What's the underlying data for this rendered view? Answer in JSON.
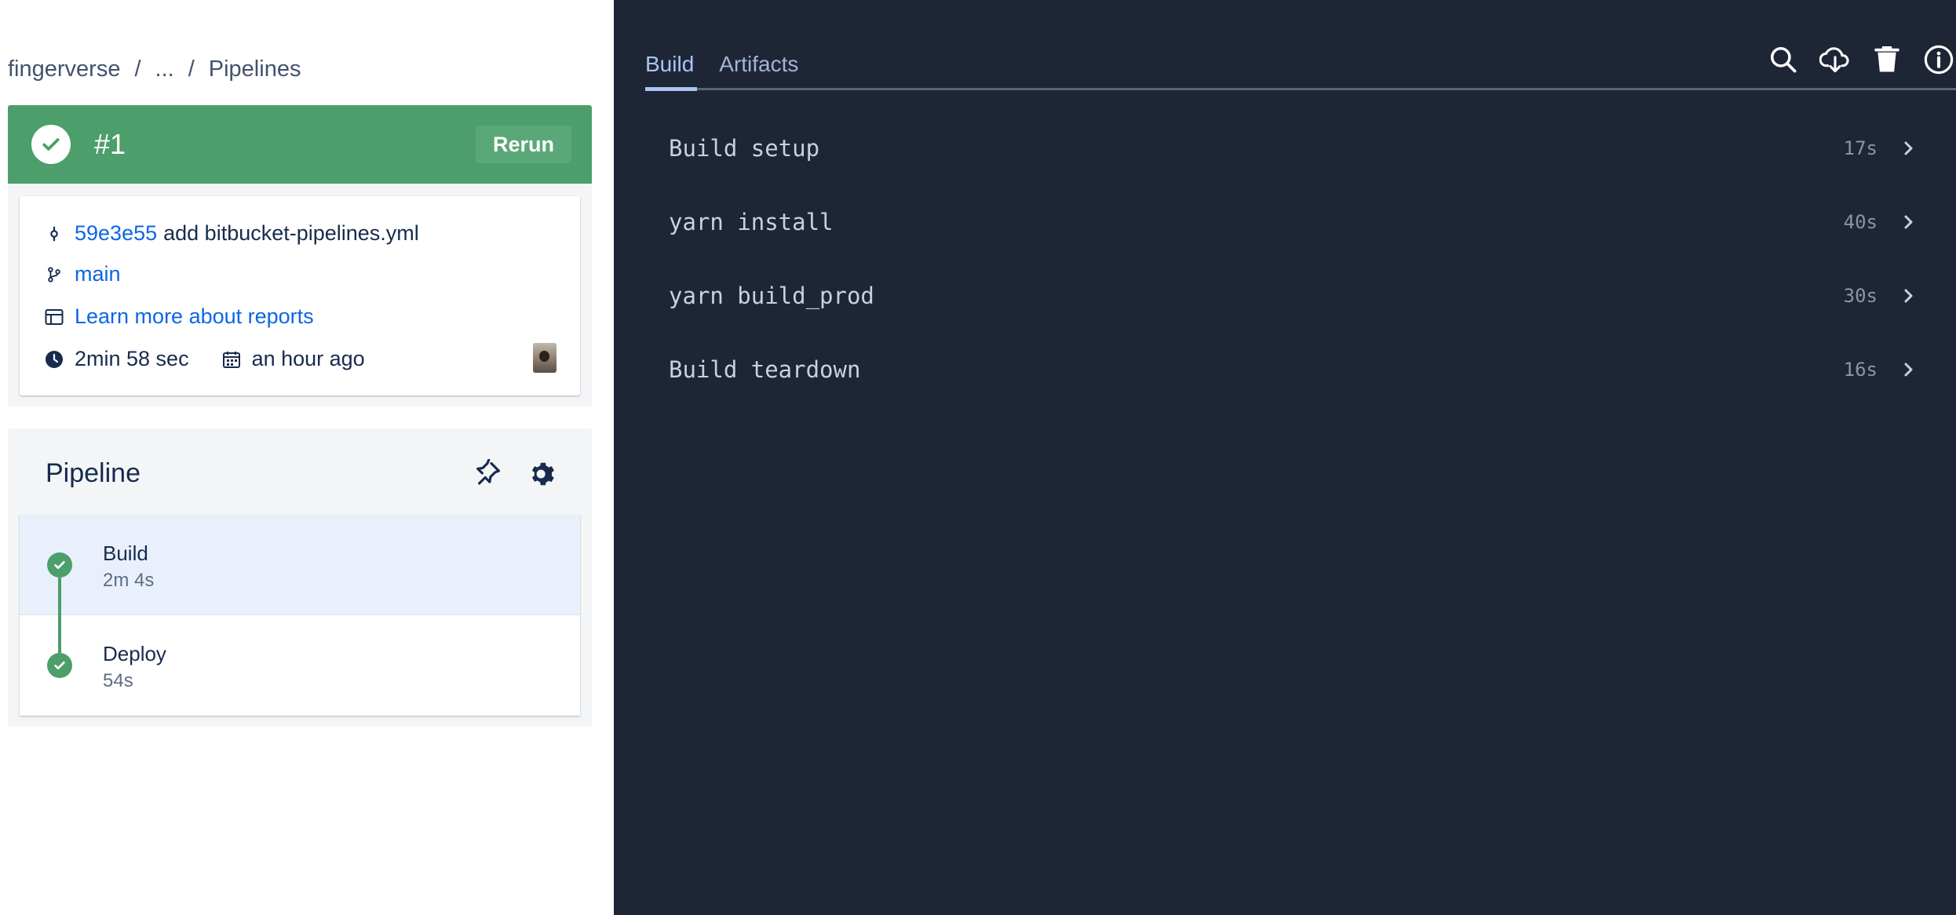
{
  "breadcrumb": {
    "workspace": "fingerverse",
    "ellipsis": "...",
    "page": "Pipelines",
    "separator": "/"
  },
  "run": {
    "number": "#1",
    "rerun_label": "Rerun",
    "status_color": "#4c9e6a"
  },
  "details": {
    "commit_hash": "59e3e55",
    "commit_message": "add bitbucket-pipelines.yml",
    "branch": "main",
    "reports_link": "Learn more about reports",
    "duration": "2min 58 sec",
    "started": "an hour ago"
  },
  "pipeline": {
    "title": "Pipeline",
    "steps": [
      {
        "name": "Build",
        "duration": "2m 4s",
        "status": "success"
      },
      {
        "name": "Deploy",
        "duration": "54s",
        "status": "success"
      }
    ]
  },
  "log_panel": {
    "tabs": [
      {
        "label": "Build",
        "active": true
      },
      {
        "label": "Artifacts",
        "active": false
      }
    ],
    "toolbar_icons": [
      "search-icon",
      "download-cloud-icon",
      "trash-icon",
      "info-icon"
    ],
    "steps": [
      {
        "label": "Build setup",
        "duration": "17s"
      },
      {
        "label": "yarn install",
        "duration": "40s"
      },
      {
        "label": "yarn build_prod",
        "duration": "30s"
      },
      {
        "label": "Build teardown",
        "duration": "16s"
      }
    ]
  },
  "colors": {
    "success": "#4c9e6a",
    "link": "#0c66e4",
    "log_background": "#1e2535"
  }
}
